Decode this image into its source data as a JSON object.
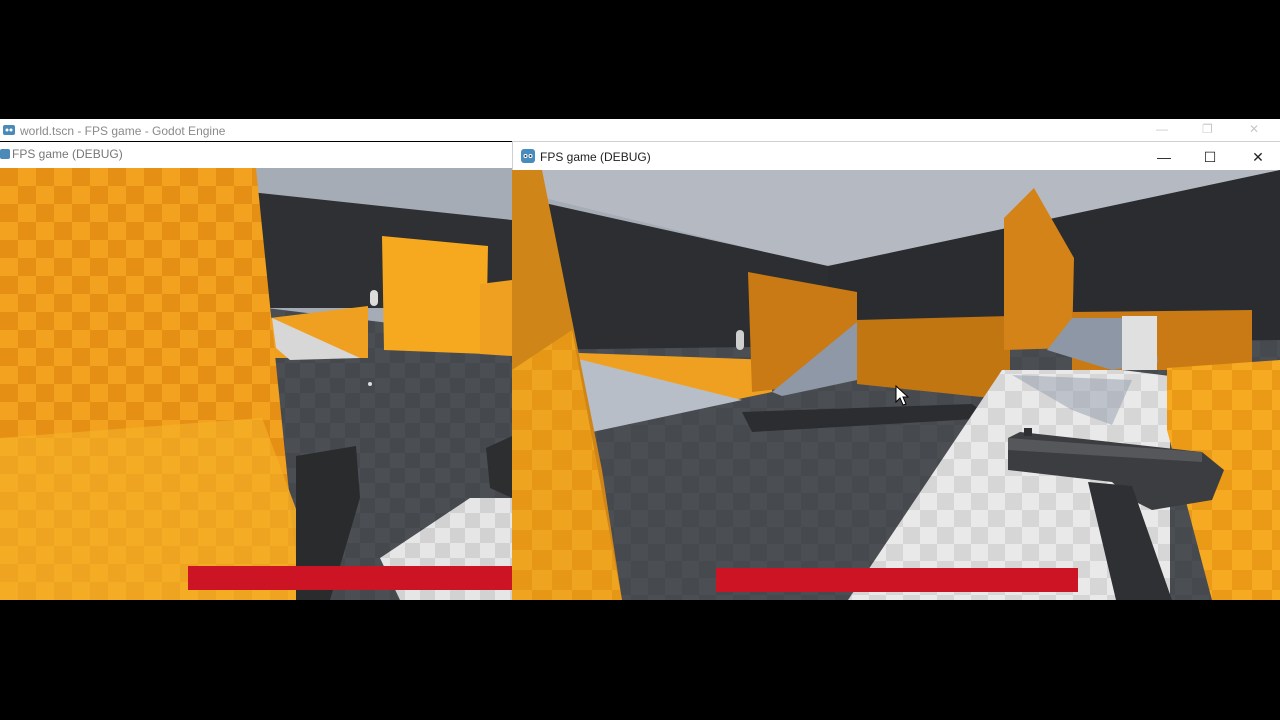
{
  "editor": {
    "title": "world.tscn - FPS game - Godot Engine"
  },
  "left_window": {
    "title": "FPS game (DEBUG)",
    "health_fraction": 1.0
  },
  "right_window": {
    "title": "FPS game (DEBUG)",
    "controls": {
      "minimize": "—",
      "maximize": "☐",
      "close": "✕"
    },
    "health_fraction": 1.0
  },
  "colors": {
    "health_bar": "#cc1424",
    "orange_wall": "#f2a21e",
    "orange_dark": "#b46d12",
    "floor": "#4a4d52",
    "sky": "#a7adb7",
    "dark_wall": "#2c2e31"
  },
  "icons": [
    "godot-icon",
    "minimize-icon",
    "maximize-icon",
    "close-icon",
    "mouse-cursor-icon",
    "pistol-icon",
    "crosshair-icon"
  ]
}
